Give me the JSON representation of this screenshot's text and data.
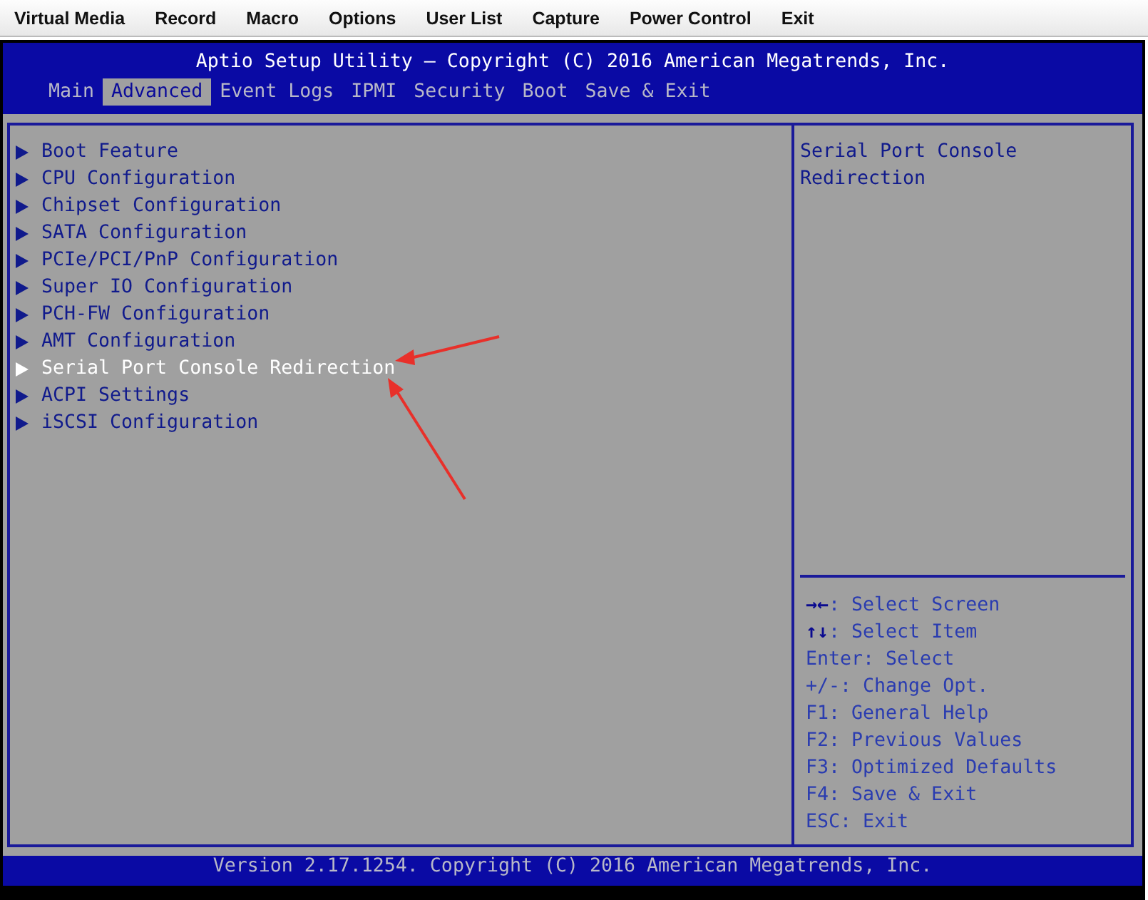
{
  "menu_bar": [
    "Virtual Media",
    "Record",
    "Macro",
    "Options",
    "User List",
    "Capture",
    "Power Control",
    "Exit"
  ],
  "header": {
    "title": "Aptio Setup Utility – Copyright (C) 2016 American Megatrends, Inc."
  },
  "tabs": [
    {
      "label": "Main",
      "selected": false
    },
    {
      "label": "Advanced",
      "selected": true
    },
    {
      "label": "Event Logs",
      "selected": false
    },
    {
      "label": "IPMI",
      "selected": false
    },
    {
      "label": "Security",
      "selected": false
    },
    {
      "label": "Boot",
      "selected": false
    },
    {
      "label": "Save & Exit",
      "selected": false
    }
  ],
  "menu_items": [
    {
      "label": "Boot Feature",
      "selected": false
    },
    {
      "label": "CPU Configuration",
      "selected": false
    },
    {
      "label": "Chipset Configuration",
      "selected": false
    },
    {
      "label": "SATA Configuration",
      "selected": false
    },
    {
      "label": "PCIe/PCI/PnP Configuration",
      "selected": false
    },
    {
      "label": "Super IO Configuration",
      "selected": false
    },
    {
      "label": "PCH-FW Configuration",
      "selected": false
    },
    {
      "label": "AMT Configuration",
      "selected": false
    },
    {
      "label": "Serial Port Console Redirection",
      "selected": true
    },
    {
      "label": "ACPI Settings",
      "selected": false
    },
    {
      "label": "iSCSI Configuration",
      "selected": false
    }
  ],
  "help_text": "Serial Port Console Redirection",
  "key_help": [
    {
      "key": "→←",
      "text": ": Select Screen"
    },
    {
      "key": "↑↓",
      "text": ": Select Item"
    },
    {
      "text": "Enter: Select"
    },
    {
      "text": "+/-: Change Opt."
    },
    {
      "text": "F1: General Help"
    },
    {
      "text": "F2: Previous Values"
    },
    {
      "text": "F3: Optimized Defaults"
    },
    {
      "text": "F4: Save & Exit"
    },
    {
      "text": "ESC: Exit"
    }
  ],
  "footer": "Version 2.17.1254. Copyright (C) 2016 American Megatrends, Inc."
}
